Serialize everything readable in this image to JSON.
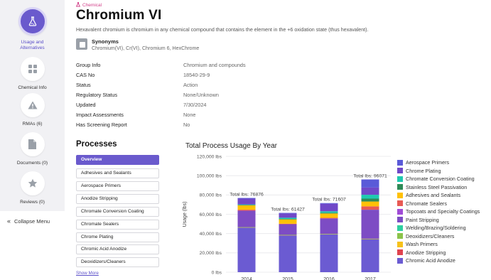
{
  "sidebar": {
    "items": [
      {
        "label": "Usage and Alternatives",
        "label_line1": "Usage and",
        "label_line2": "Alternatives",
        "icon": "flask-icon",
        "active": true
      },
      {
        "label": "Chemical Info",
        "icon": "grid-icon",
        "active": false
      },
      {
        "label": "RMAs (6)",
        "icon": "warning-icon",
        "active": false
      },
      {
        "label": "Documents (0)",
        "icon": "document-icon",
        "active": false
      },
      {
        "label": "Reviews (0)",
        "icon": "star-icon",
        "active": false
      }
    ],
    "collapse_label": "Collapse Menu"
  },
  "header": {
    "kicker": "Chemical",
    "title": "Chromium VI",
    "description": "Hexavalent chromium is chromium in any chemical compound that contains the element in the +6 oxidation state (thus hexavalent)."
  },
  "synonyms": {
    "title": "Synonyms",
    "values": "Chromium(VI), Cr(VI), Chromium 6, HexChrome"
  },
  "info": [
    {
      "key": "Group Info",
      "value": "Chromium and compounds"
    },
    {
      "key": "CAS No",
      "value": "18540-29-9"
    },
    {
      "key": "Status",
      "value": "Action"
    },
    {
      "key": "Regulatory Status",
      "value": "None/Unknown"
    },
    {
      "key": "Updated",
      "value": "7/30/2024"
    },
    {
      "key": "Impact Assessments",
      "value": "None"
    },
    {
      "key": "Has Screening Report",
      "value": "No"
    }
  ],
  "processes": {
    "title": "Processes",
    "items": [
      {
        "label": "Overview",
        "selected": true
      },
      {
        "label": "Adhesives and Sealants",
        "selected": false
      },
      {
        "label": "Aerospace Primers",
        "selected": false
      },
      {
        "label": "Anodize Stripping",
        "selected": false
      },
      {
        "label": "Chromate Conversion Coating",
        "selected": false
      },
      {
        "label": "Chromate Sealers",
        "selected": false
      },
      {
        "label": "Chrome Plating",
        "selected": false
      },
      {
        "label": "Chromic Acid Anodize",
        "selected": false
      },
      {
        "label": "Deoxidizers/Cleaners",
        "selected": false
      }
    ],
    "show_more": "Show More"
  },
  "chart_data": {
    "type": "bar",
    "stacked": true,
    "title": "Total Process Usage By Year",
    "ylabel": "Usage (lbs)",
    "xlabel": "",
    "ylim": [
      0,
      120000
    ],
    "yticks": [
      0,
      20000,
      40000,
      60000,
      80000,
      100000,
      120000
    ],
    "ytick_labels": [
      "0 lbs",
      "20,000 lbs",
      "40,000 lbs",
      "60,000 lbs",
      "80,000 lbs",
      "100,000 lbs",
      "120,000 lbs"
    ],
    "categories": [
      "2014",
      "2015",
      "2016",
      "2017"
    ],
    "totals": [
      76876,
      61427,
      71607,
      96071
    ],
    "total_labels": [
      "Total lbs: 76876",
      "Total lbs: 61427",
      "Total lbs: 71607",
      "Total lbs: 96071"
    ],
    "grid": true,
    "legend_position": "right",
    "series": [
      {
        "name": "Chromic Acid Anodize",
        "color": "#6b5bd2",
        "values": [
          46000,
          38000,
          39000,
          34000
        ]
      },
      {
        "name": "Anodize Stripping",
        "color": "#e0434f",
        "values": [
          200,
          200,
          200,
          200
        ]
      },
      {
        "name": "Wash Primers",
        "color": "#f7c21b",
        "values": [
          0,
          0,
          0,
          0
        ]
      },
      {
        "name": "Deoxidizers/Cleaners",
        "color": "#8bc34a",
        "values": [
          500,
          500,
          500,
          500
        ]
      },
      {
        "name": "Welding/Brazing/Soldering",
        "color": "#2ecfa0",
        "values": [
          0,
          0,
          0,
          0
        ]
      },
      {
        "name": "Paint Stripping",
        "color": "#7d4cc4",
        "values": [
          17000,
          11000,
          16000,
          30000
        ]
      },
      {
        "name": "Topcoats and Specialty Coatings",
        "color": "#a04bd6",
        "values": [
          0,
          0,
          0,
          0
        ]
      },
      {
        "name": "Chromate Sealers",
        "color": "#e85a54",
        "values": [
          1000,
          500,
          600,
          3500
        ]
      },
      {
        "name": "Adhesives and Sealants",
        "color": "#ffc107",
        "values": [
          4500,
          4500,
          4500,
          5000
        ]
      },
      {
        "name": "Stainless Steel Passivation",
        "color": "#2e8b57",
        "values": [
          500,
          500,
          800,
          3000
        ]
      },
      {
        "name": "Chromate Conversion Coating",
        "color": "#1fc9b0",
        "values": [
          500,
          1200,
          1500,
          4000
        ]
      },
      {
        "name": "Chrome Plating",
        "color": "#7048c8",
        "values": [
          6000,
          4400,
          7800,
          7500
        ]
      },
      {
        "name": "Aerospace Primers",
        "color": "#5a5ad8",
        "values": [
          676,
          627,
          707,
          8371
        ]
      }
    ],
    "legend_order": [
      "Aerospace Primers",
      "Chrome Plating",
      "Chromate Conversion Coating",
      "Stainless Steel Passivation",
      "Adhesives and Sealants",
      "Chromate Sealers",
      "Topcoats and Specialty Coatings",
      "Paint Stripping",
      "Welding/Brazing/Soldering",
      "Deoxidizers/Cleaners",
      "Wash Primers",
      "Anodize Stripping",
      "Chromic Acid Anodize"
    ]
  },
  "colors": {
    "accent": "#6a5acd",
    "kicker": "#d2418a"
  }
}
